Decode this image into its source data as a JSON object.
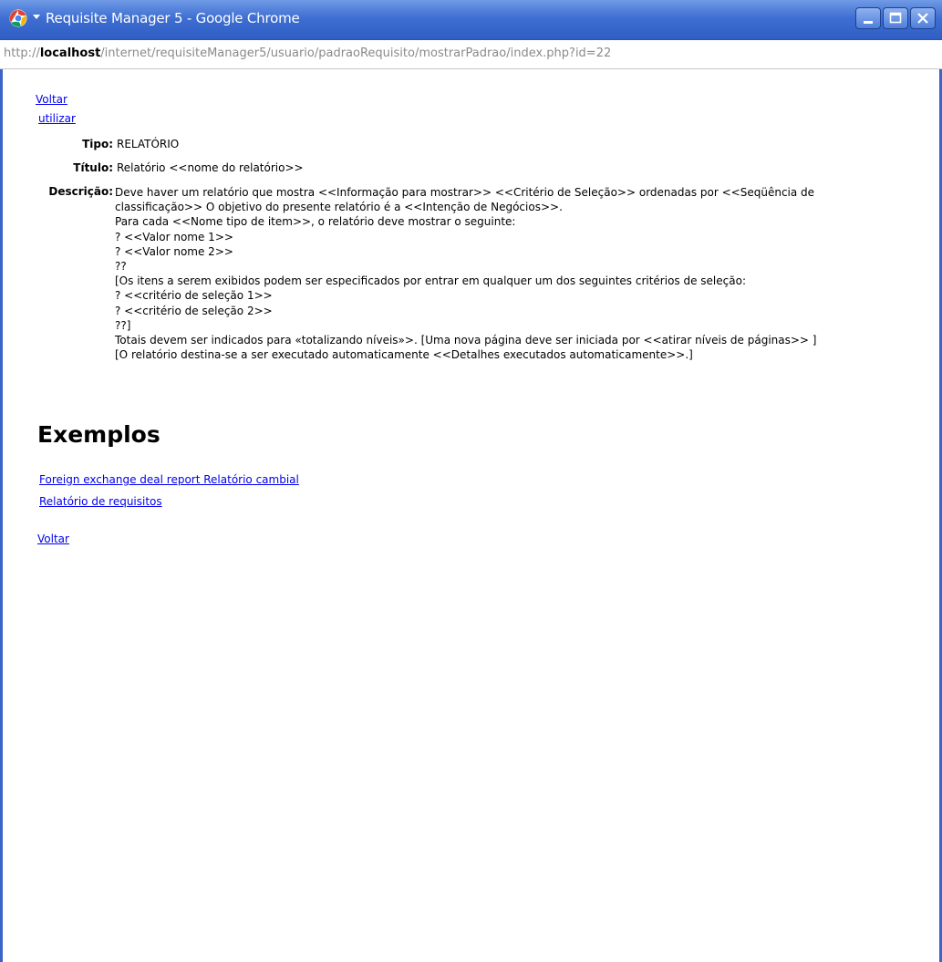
{
  "window": {
    "title": "Requisite Manager 5 - Google Chrome"
  },
  "address_bar": {
    "url_prefix": "http://",
    "url_host": "localhost",
    "url_path": "/internet/requisiteManager5/usuario/padraoRequisito/mostrarPadrao/index.php?id=22"
  },
  "page": {
    "top_links": {
      "back": "Voltar",
      "use": "utilizar"
    },
    "fields": {
      "tipo_label": "Tipo:",
      "tipo_value": "RELATÓRIO",
      "titulo_label": "Título:",
      "titulo_value": "Relatório <<nome do relatório>>",
      "descricao_label": "Descrição:",
      "descricao_lines": [
        "Deve haver um relatório que mostra <<Informação para mostrar>> <<Critério de Seleção>> ordenadas por <<Seqüência de",
        "classificação>> O objetivo do presente relatório é a <<Intenção de Negócios>>.",
        "Para cada <<Nome tipo de item>>, o relatório deve mostrar o seguinte:",
        "? <<Valor nome 1>>",
        "? <<Valor nome 2>>",
        "??",
        "[Os itens a serem exibidos podem ser especificados por entrar em qualquer um dos seguintes critérios de seleção:",
        "? <<critério de seleção 1>>",
        "? <<critério de seleção 2>>",
        "??]",
        "Totais devem ser indicados para «totalizando níveis»>. [Uma nova página deve ser iniciada por <<atirar níveis de páginas>> ]",
        "[O relatório destina-se a ser executado automaticamente <<Detalhes executados automaticamente>>.]"
      ]
    },
    "examples": {
      "heading": "Exemplos",
      "links": [
        "Foreign exchange deal report Relatório cambial",
        "Relatório de requisitos"
      ]
    },
    "bottom_link": "Voltar"
  },
  "colors": {
    "title_bar": "#3f6fd2",
    "link": "#0000ee",
    "url_gray": "#8a8a8a"
  },
  "icons": {
    "browser_logo": "chrome-logo-icon",
    "minimize": "minimize-icon",
    "maximize": "maximize-icon",
    "close": "close-icon"
  }
}
